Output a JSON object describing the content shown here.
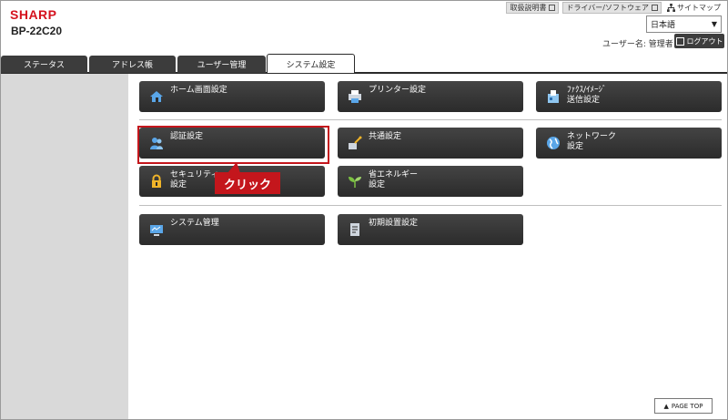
{
  "header": {
    "brand": "SHARP",
    "model": "BP-22C20",
    "links": {
      "manual": "取扱説明書",
      "driver": "ドライバー/ソフトウェア",
      "sitemap": "サイトマップ"
    },
    "language": "日本語",
    "user": "ユーザー名: 管理者",
    "logout": "ログアウト",
    "brand_color": "#d5121e"
  },
  "tabs": [
    "ステータス",
    "アドレス帳",
    "ユーザー管理",
    "システム設定"
  ],
  "active_tab": "システム設定",
  "menu": {
    "home": "ホーム画面設定",
    "printer": "プリンター設定",
    "fax_line1": "ﾌｧｸｽ/ｲﾒｰｼﾞ",
    "fax_line2": "送信設定",
    "auth": "認証設定",
    "common": "共通設定",
    "network_line1": "ネットワーク",
    "network_line2": "設定",
    "security_line1": "セキュリティ",
    "security_line2": "設定",
    "energy_line1": "省エネルギー",
    "energy_line2": "設定",
    "sysadmin": "システム管理",
    "initial": "初期設置設定"
  },
  "annotation": {
    "callout": "クリック",
    "color": "#c4161c"
  },
  "footer": {
    "page_top": "PAGE TOP"
  }
}
